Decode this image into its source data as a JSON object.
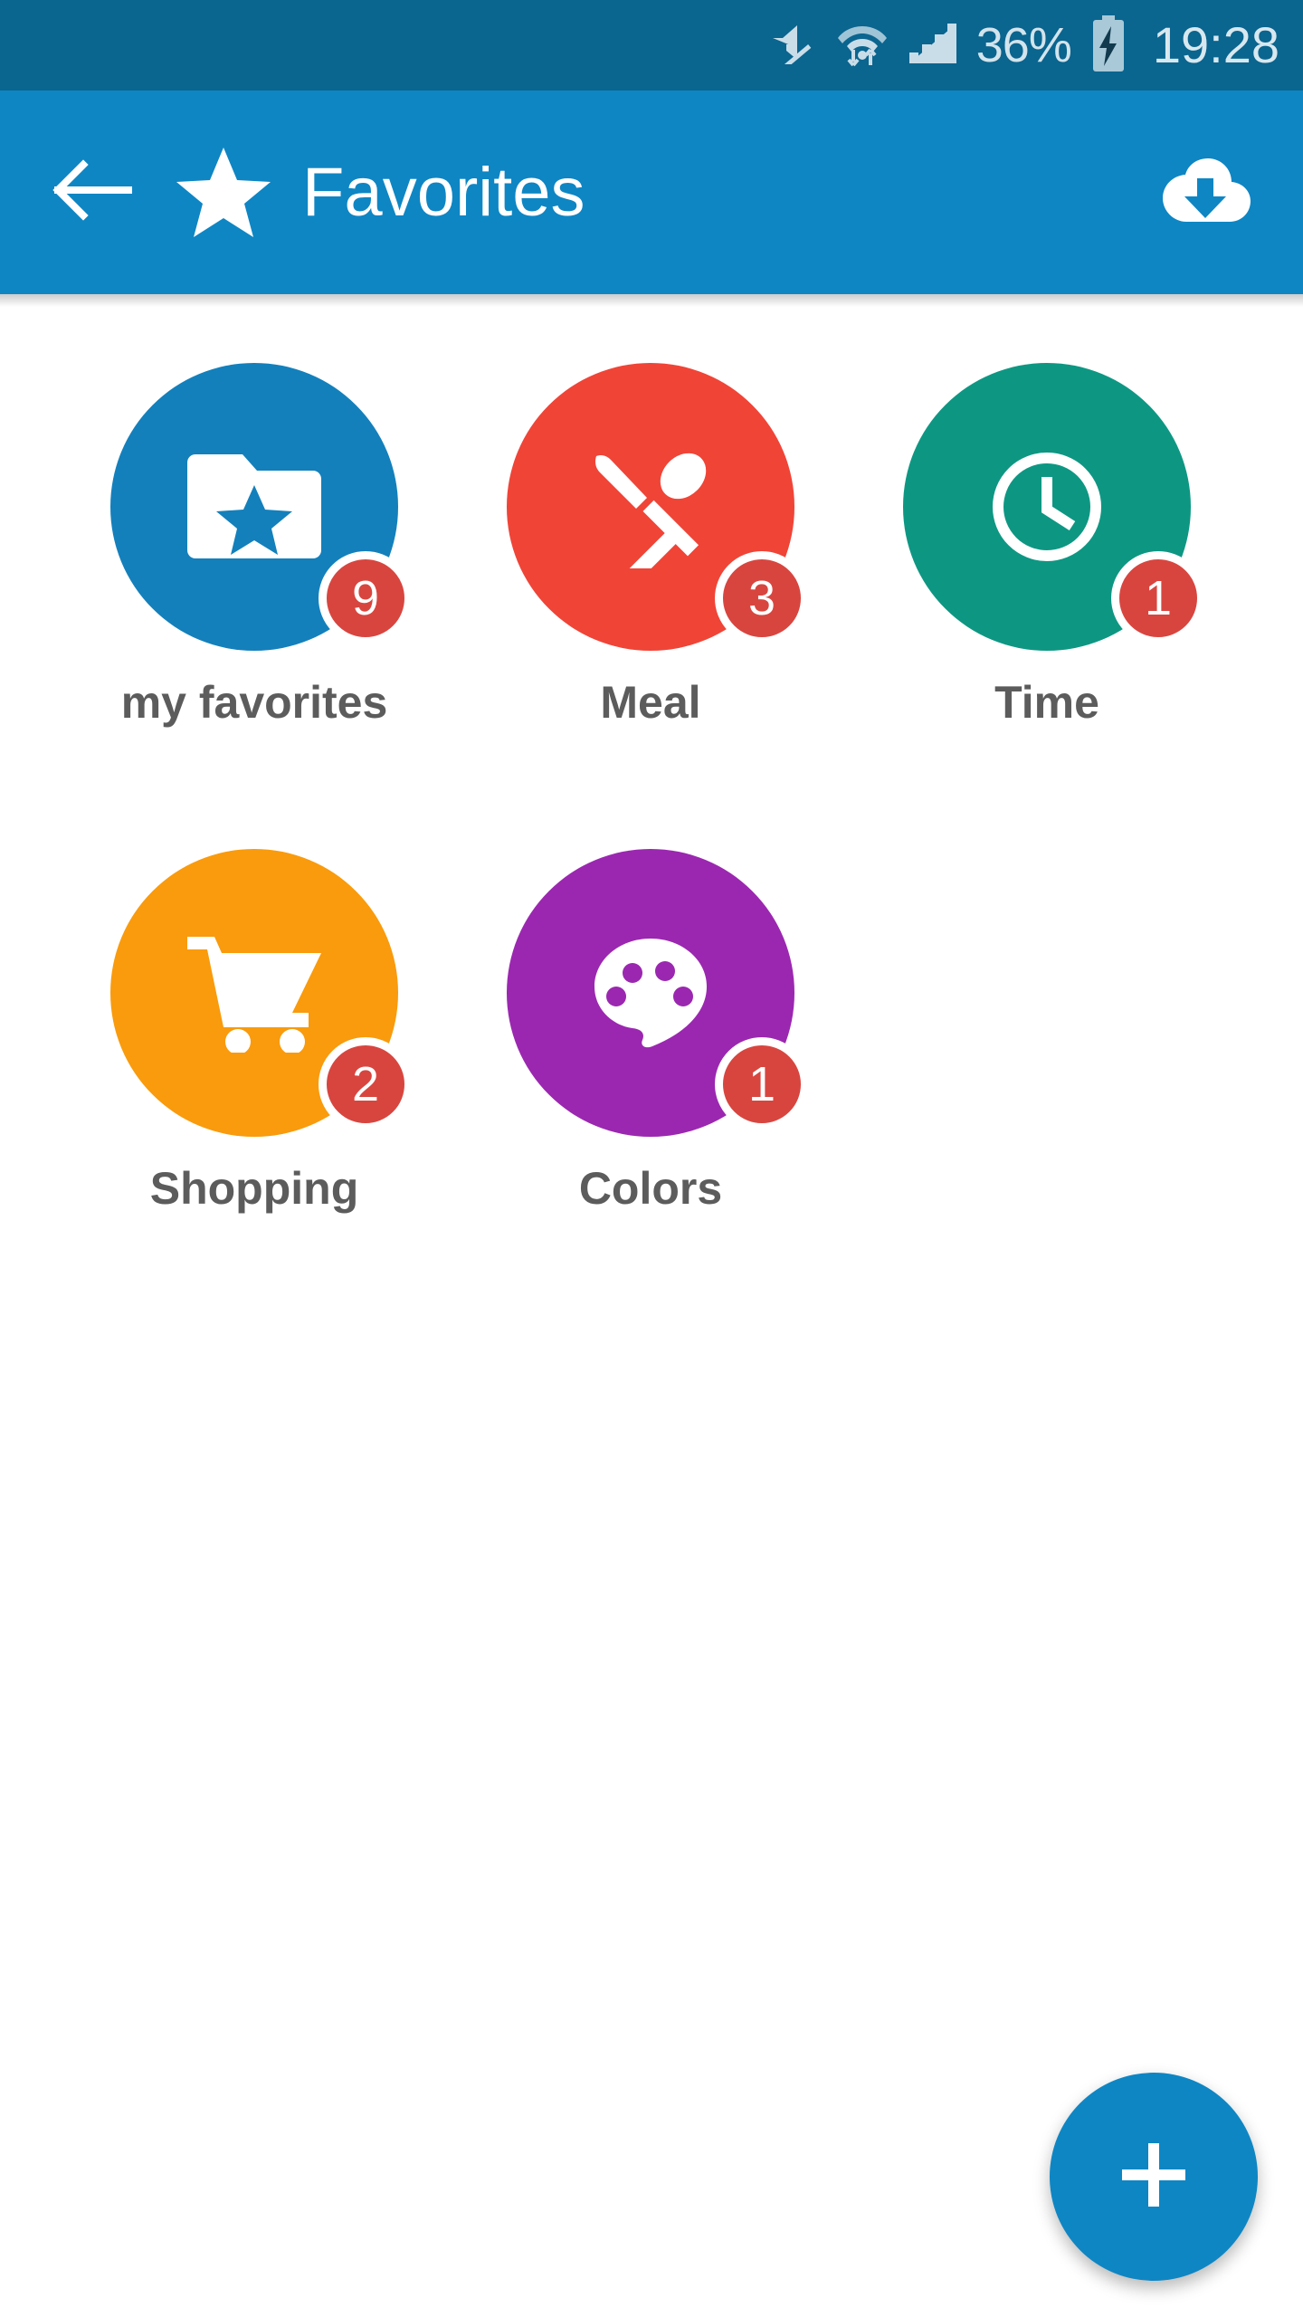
{
  "status_bar": {
    "background": "#0A658F",
    "icons": [
      "mute-icon",
      "wifi-icon",
      "cellular-signal-icon",
      "battery-charging-icon"
    ],
    "battery_percent": "36%",
    "clock": "19:28"
  },
  "app_bar": {
    "background": "#0E86C4",
    "back_icon": "arrow-left-icon",
    "leading_icon": "star-icon",
    "title": "Favorites",
    "action_icon": "cloud-download-icon"
  },
  "categories": [
    {
      "label": "my favorites",
      "badge": "9",
      "color": "#1380BC",
      "icon": "folder-star-icon"
    },
    {
      "label": "Meal",
      "badge": "3",
      "color": "#F04437",
      "icon": "knife-spoon-icon"
    },
    {
      "label": "Time",
      "badge": "1",
      "color": "#0D9783",
      "icon": "clock-icon"
    },
    {
      "label": "Shopping",
      "badge": "2",
      "color": "#F99B0C",
      "icon": "shopping-cart-icon"
    },
    {
      "label": "Colors",
      "badge": "1",
      "color": "#9B27B0",
      "icon": "palette-icon"
    }
  ],
  "fab": {
    "icon": "plus-icon",
    "color": "#0E86C4",
    "label": "+"
  },
  "theme": {
    "badge_color": "#D8453F",
    "label_color": "#5C5C5C",
    "page_background": "#FFFFFF"
  }
}
